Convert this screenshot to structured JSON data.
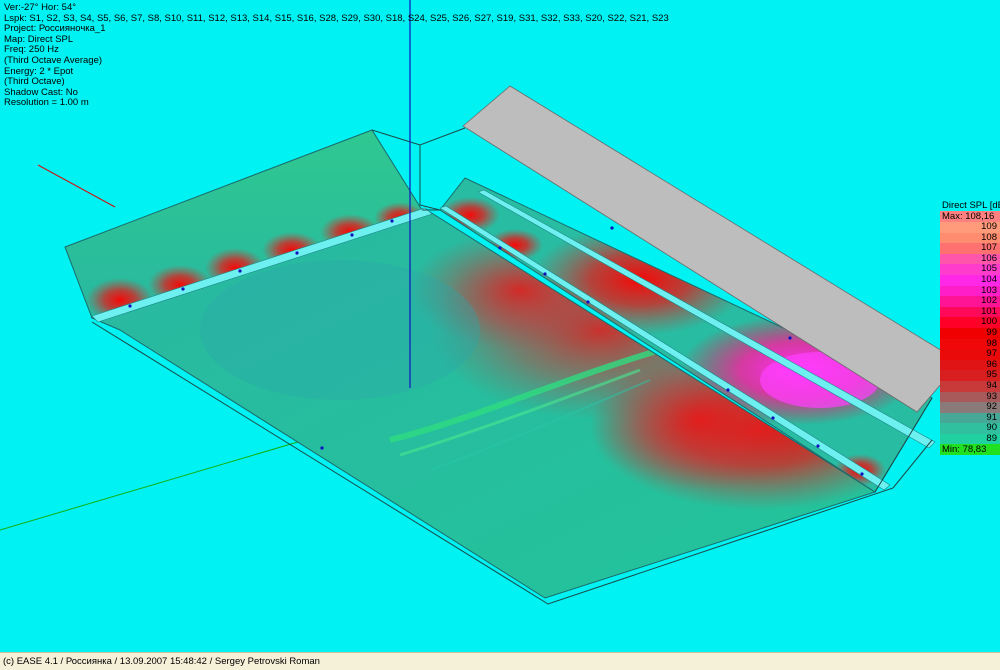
{
  "info_lines": [
    "Ver:-27°   Hor: 54°",
    "Lspk: S1, S2, S3, S4, S5, S6, S7, S8, S10, S11, S12, S13, S14, S15, S16, S28, S29, S30, S18, S24, S25, S26, S27, S19, S31, S32, S33, S20, S22, S21, S23",
    "Project: Россияночка_1",
    "Map: Direct SPL",
    "Freq: 250 Hz",
    "(Third Octave Average)",
    "Energy: 2 * Epot",
    "(Third Octave)",
    "Shadow Cast: No",
    "Resolution =   1.00 m"
  ],
  "legend": {
    "title": "Direct SPL [dB]",
    "max_label": "Max:  108,16",
    "min_label": "Min:   78,83",
    "levels": [
      {
        "label": "109",
        "color": "#ff9a7a"
      },
      {
        "label": "108",
        "color": "#ff8c6e"
      },
      {
        "label": "107",
        "color": "#ff7070"
      },
      {
        "label": "106",
        "color": "#ff55aa"
      },
      {
        "label": "105",
        "color": "#ff3ccc"
      },
      {
        "label": "104",
        "color": "#ff28e6"
      },
      {
        "label": "103",
        "color": "#ff1ec8"
      },
      {
        "label": "102",
        "color": "#ff1496"
      },
      {
        "label": "101",
        "color": "#ff0a5a"
      },
      {
        "label": "100",
        "color": "#ff0028"
      },
      {
        "label": "99",
        "color": "#f00000"
      },
      {
        "label": "98",
        "color": "#f00808"
      },
      {
        "label": "97",
        "color": "#ea0a0a"
      },
      {
        "label": "96",
        "color": "#e01414"
      },
      {
        "label": "95",
        "color": "#d81e1e"
      },
      {
        "label": "94",
        "color": "#c83a3a"
      },
      {
        "label": "93",
        "color": "#a85a5a"
      },
      {
        "label": "92",
        "color": "#8a7a7a"
      },
      {
        "label": "91",
        "color": "#48a898"
      },
      {
        "label": "90",
        "color": "#30c0a0"
      },
      {
        "label": "89",
        "color": "#20d0a0"
      }
    ]
  },
  "status_bar": "(c) EASE 4.1  / Россиянка  / 13.09.2007 15:48:42 / Sergey Petrovski Roman",
  "colors": {
    "background": "#00f2f2",
    "floor": "#23bf9a",
    "spl_hot": "#ff1010",
    "spl_peak": "#ff2ad8",
    "screen": "#bdbdbd"
  }
}
